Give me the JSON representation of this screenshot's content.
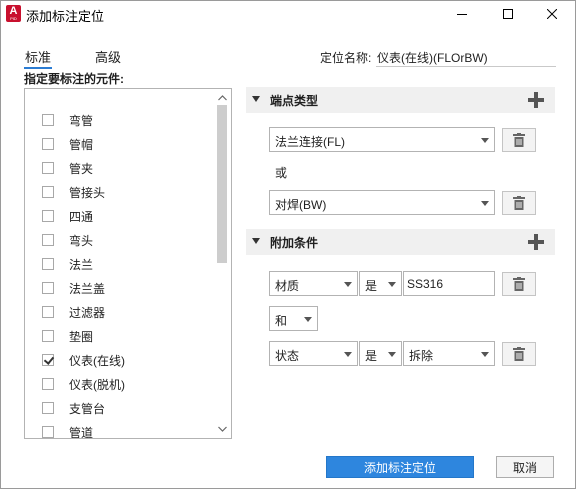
{
  "window": {
    "title": "添加标注定位",
    "app_icon": "A",
    "app_icon_sub": "PID"
  },
  "tabs": [
    "标准",
    "高级"
  ],
  "location_name": {
    "label": "定位名称:",
    "value": "仪表(在线)(FLOrBW)"
  },
  "elements_label": "指定要标注的元件:",
  "elements": [
    {
      "label": "弯管",
      "checked": false
    },
    {
      "label": "管帽",
      "checked": false
    },
    {
      "label": "管夹",
      "checked": false
    },
    {
      "label": "管接头",
      "checked": false
    },
    {
      "label": "四通",
      "checked": false
    },
    {
      "label": "弯头",
      "checked": false
    },
    {
      "label": "法兰",
      "checked": false
    },
    {
      "label": "法兰盖",
      "checked": false
    },
    {
      "label": "过滤器",
      "checked": false
    },
    {
      "label": "垫圈",
      "checked": false
    },
    {
      "label": "仪表(在线)",
      "checked": true
    },
    {
      "label": "仪表(脱机)",
      "checked": false
    },
    {
      "label": "支管台",
      "checked": false
    },
    {
      "label": "管道",
      "checked": false
    }
  ],
  "endpoint_section": {
    "title": "端点类型",
    "first": "法兰连接(FL)",
    "or_label": "或",
    "second": "对焊(BW)"
  },
  "conditions_section": {
    "title": "附加条件",
    "row1": {
      "property": "材质",
      "operator": "是",
      "value": "SS316"
    },
    "logic": "和",
    "row2": {
      "property": "状态",
      "operator": "是",
      "value": "拆除"
    }
  },
  "buttons": {
    "add": "添加标注定位",
    "cancel": "取消"
  },
  "colors": {
    "accent": "#2e86de",
    "app_icon": "#c8102e"
  }
}
